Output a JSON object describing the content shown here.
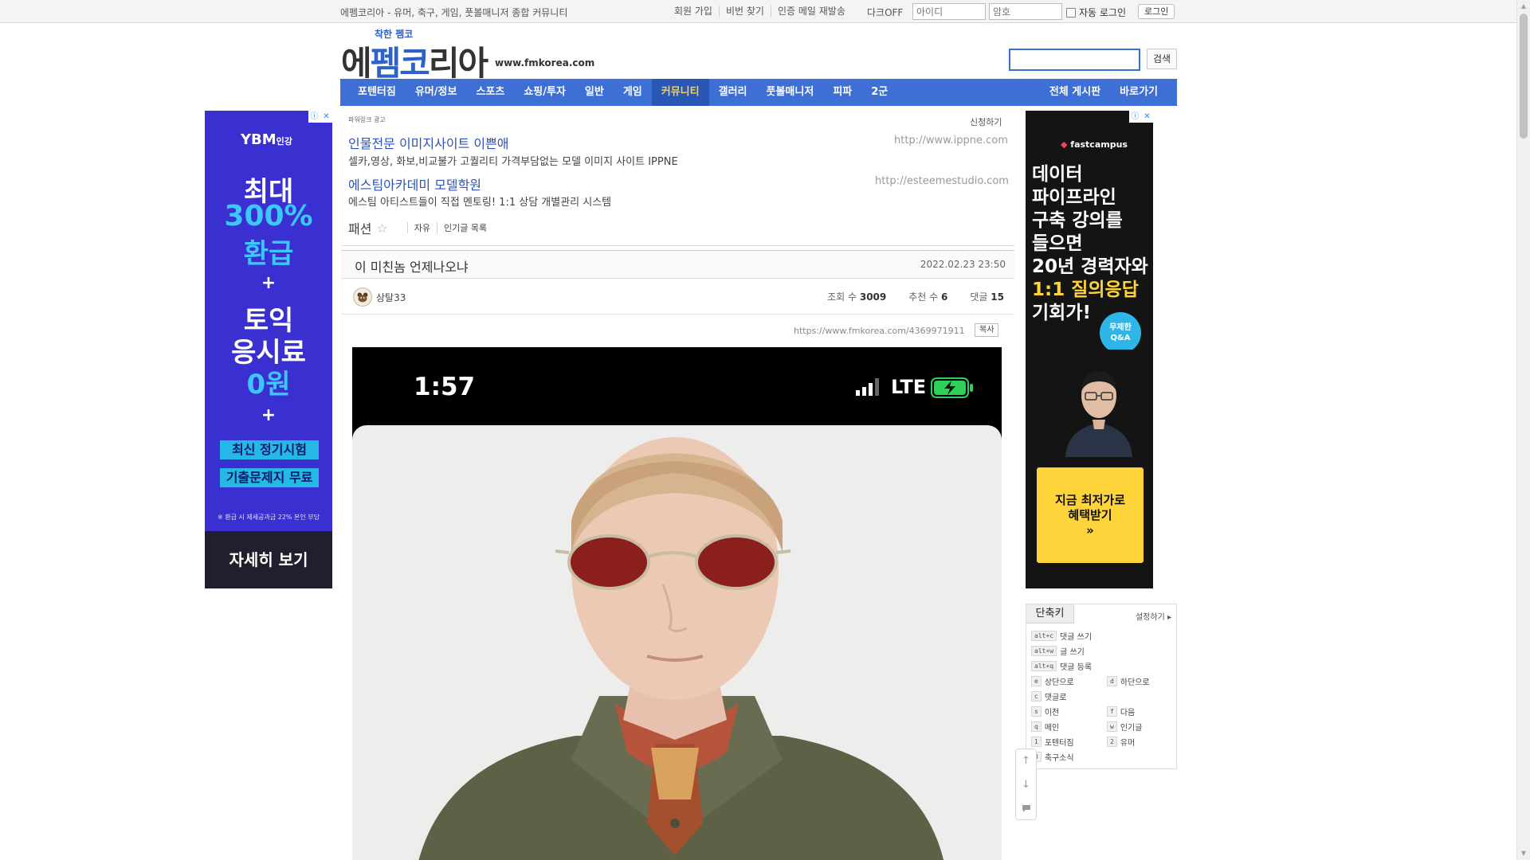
{
  "topbar": {
    "slogan": "에펨코리아 - 유머, 축구, 게임, 풋볼매니저 종합 커뮤니티",
    "links": [
      "회원 가입",
      "비번 찾기",
      "인증 메일 재발송"
    ],
    "dark_toggle": "다크OFF",
    "id_placeholder": "아이디",
    "pw_placeholder": "암호",
    "auto_login": "자동 로그인",
    "login_button": "로그인"
  },
  "header": {
    "logo_small": "착한 펨코",
    "logo_part1": "에",
    "logo_part2": "펨코",
    "logo_part3": "리아",
    "site_url": "www.fmkorea.com",
    "search_button": "검색"
  },
  "nav": {
    "items": [
      "포텐터짐",
      "유머/정보",
      "스포츠",
      "쇼핑/투자",
      "일반",
      "게임",
      "커뮤니티",
      "갤러리",
      "풋볼매니저",
      "피파",
      "2군"
    ],
    "active": "커뮤니티",
    "right_items": [
      "전체 게시판",
      "바로가기"
    ]
  },
  "ads": {
    "left": {
      "brand": "YBM",
      "brand_sub": "인강",
      "line1": "최대",
      "line2": "300%",
      "line3": "환급",
      "plus": "+",
      "line4": "토익",
      "line5": "응시료",
      "line6": "0원",
      "box1": "최신 정기시험",
      "box2": "기출문제지 무료",
      "note": "※ 환급 시 제세공과금 22% 본인 부담",
      "cta": "자세히 보기"
    },
    "right": {
      "brand": "fastcampus",
      "lines": [
        "데이터",
        "파이프라인",
        "구축 강의를",
        "들으면",
        "20년 경력자와"
      ],
      "highlight": "1:1 질의응답",
      "last_line": "기회가!",
      "badge_line1": "무제한",
      "badge_line2": "Q&A",
      "cta_line1": "지금 최저가로",
      "cta_line2": "혜택받기",
      "cta_line3": "»"
    },
    "close_icons": [
      "ⓘ",
      "✕"
    ]
  },
  "powerlink": {
    "label": "파워링크 광고",
    "apply": "신청하기",
    "entries": [
      {
        "title": "인물전문 이미지사이트 이쁜애",
        "desc": "셀카,영상, 화보,비교불가 고퀄리티 가격부담없는 모델 이미지 사이트 IPPNE",
        "url": "http://www.ippne.com"
      },
      {
        "title": "에스팀아카데미 모델학원",
        "desc": "에스팀 아티스트들이 직접 멘토링! 1:1 상담 개별관리 시스템",
        "url": "http://esteemestudio.com"
      }
    ]
  },
  "board": {
    "name": "패션",
    "links": [
      "자유",
      "인기글 목록"
    ]
  },
  "article": {
    "title": "이 미친놈 언제나오냐",
    "date": "2022.02.23 23:50",
    "author": "상탈33",
    "views_label": "조회 수",
    "views": "3009",
    "recommend_label": "추천 수",
    "recommend": "6",
    "comments_label": "댓글",
    "comments": "15",
    "permalink": "https://www.fmkorea.com/4369971911",
    "copy_button": "복사"
  },
  "photo": {
    "time": "1:57",
    "network": "LTE"
  },
  "shortcut": {
    "tab": "단축키",
    "settings": "설정하기",
    "rows": [
      {
        "key": "alt+c",
        "label": "댓글 쓰기"
      },
      {
        "key": "alt+w",
        "label": "글 쓰기"
      },
      {
        "key": "alt+q",
        "label": "댓글 등록"
      },
      {
        "key": "e",
        "label": "상단으로"
      },
      {
        "key": "d",
        "label": "하단으로"
      },
      {
        "key": "c",
        "label": "댓글로"
      },
      {
        "key": "s",
        "label": "이전"
      },
      {
        "key": "f",
        "label": "다음"
      },
      {
        "key": "q",
        "label": "메인"
      },
      {
        "key": "w",
        "label": "인기글"
      },
      {
        "key": "1",
        "label": "포텐터짐"
      },
      {
        "key": "2",
        "label": "유머"
      },
      {
        "key": "3",
        "label": "축구소식"
      }
    ]
  },
  "colors": {
    "nav_bg": "#3e6fd4",
    "nav_active": "#ffd43b",
    "link_blue": "#2d52b8",
    "ad_left_bg": "#3a2fd0",
    "ad_right_highlight": "#ffd43b"
  }
}
